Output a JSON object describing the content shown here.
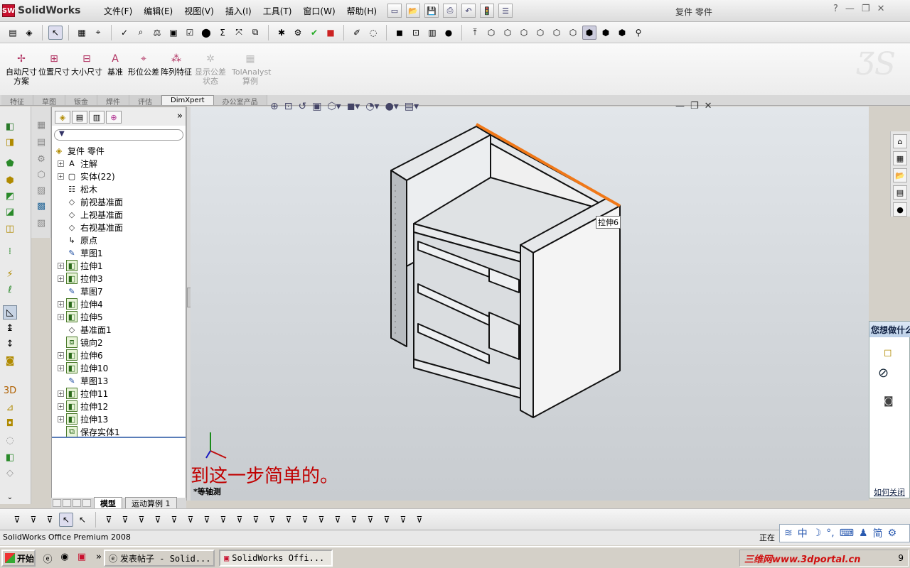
{
  "app": {
    "name": "SolidWorks",
    "doc_title": "复件 零件",
    "logo_mark": "SW"
  },
  "menus": [
    "文件(F)",
    "编辑(E)",
    "视图(V)",
    "插入(I)",
    "工具(T)",
    "窗口(W)",
    "帮助(H)"
  ],
  "window_controls": {
    "help": "?",
    "minimize": "—",
    "restore": "❐",
    "close": "✕"
  },
  "command_buttons": [
    {
      "label": "自动尺寸方案",
      "enabled": true
    },
    {
      "label": "位置尺寸",
      "enabled": true
    },
    {
      "label": "大小尺寸",
      "enabled": true
    },
    {
      "label": "基准",
      "enabled": true
    },
    {
      "label": "形位公差",
      "enabled": true
    },
    {
      "label": "阵列特征",
      "enabled": true
    },
    {
      "label": "显示公差状态",
      "enabled": false
    },
    {
      "label": "TolAnalyst 算例",
      "enabled": false
    }
  ],
  "cm_tabs": [
    "特征",
    "草图",
    "钣金",
    "焊件",
    "评估",
    "DimXpert",
    "办公室产品"
  ],
  "cm_active_tab": "DimXpert",
  "tree": {
    "root": "复件 零件",
    "items": [
      {
        "label": "注解",
        "icon": "annotation-icon",
        "expand": true
      },
      {
        "label": "实体(22)",
        "icon": "solid-bodies-icon",
        "expand": true
      },
      {
        "label": "松木",
        "icon": "material-icon",
        "expand": false
      },
      {
        "label": "前视基准面",
        "icon": "plane-icon",
        "expand": false
      },
      {
        "label": "上视基准面",
        "icon": "plane-icon",
        "expand": false
      },
      {
        "label": "右视基准面",
        "icon": "plane-icon",
        "expand": false
      },
      {
        "label": "原点",
        "icon": "origin-icon",
        "expand": false
      },
      {
        "label": "草图1",
        "icon": "sketch-icon",
        "expand": false
      },
      {
        "label": "拉伸1",
        "icon": "extrude-icon",
        "expand": true
      },
      {
        "label": "拉伸3",
        "icon": "extrude-icon",
        "expand": true
      },
      {
        "label": "草图7",
        "icon": "sketch-icon",
        "expand": false
      },
      {
        "label": "拉伸4",
        "icon": "extrude-icon",
        "expand": true
      },
      {
        "label": "拉伸5",
        "icon": "extrude-icon",
        "expand": true
      },
      {
        "label": "基准面1",
        "icon": "plane-icon",
        "expand": false
      },
      {
        "label": "镜向2",
        "icon": "mirror-icon",
        "expand": false
      },
      {
        "label": "拉伸6",
        "icon": "extrude-icon",
        "expand": true
      },
      {
        "label": "拉伸10",
        "icon": "extrude-icon",
        "expand": true
      },
      {
        "label": "草图13",
        "icon": "sketch-icon",
        "expand": false
      },
      {
        "label": "拉伸11",
        "icon": "extrude-icon",
        "expand": true
      },
      {
        "label": "拉伸12",
        "icon": "extrude-icon",
        "expand": true
      },
      {
        "label": "拉伸13",
        "icon": "extrude-icon",
        "expand": true
      },
      {
        "label": "保存实体1",
        "icon": "save-bodies-icon",
        "expand": false
      }
    ]
  },
  "fm_tabs": {
    "model": "模型",
    "motion": "运动算例 1"
  },
  "viewport": {
    "caption": "到这一步简单的。",
    "view_name": "*等轴测",
    "hover_label": "拉伸6",
    "highlight_color": "#f07818"
  },
  "task_hint": {
    "title": "您想做什么?",
    "link": "如何关闭"
  },
  "status": {
    "left": "SolidWorks Office Premium 2008",
    "right": "正在"
  },
  "ime": {
    "lang": "中",
    "mode": "简"
  },
  "taskbar": {
    "start": "开始",
    "tasks": [
      {
        "label": "发表帖子 - Solid...",
        "active": false
      },
      {
        "label": "SolidWorks Offi...",
        "active": true
      }
    ],
    "watermark": "三维网www.3dportal.cn",
    "clock": "9"
  },
  "colors": {
    "accent": "#c8102e",
    "caption": "#c00000",
    "link": "#124488"
  }
}
